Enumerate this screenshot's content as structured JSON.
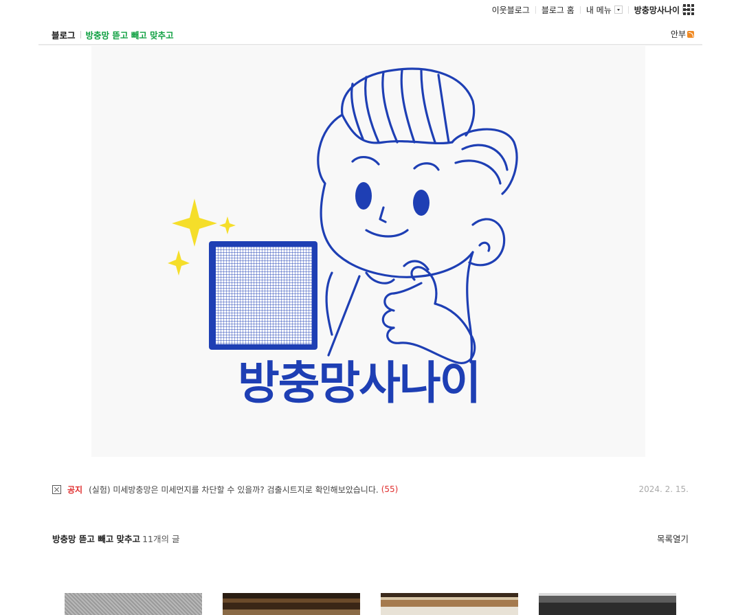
{
  "gnb": {
    "neighbor_blog": "이웃블로그",
    "blog_home": "블로그 홈",
    "my_menu": "내 메뉴",
    "user_name": "방충망사나이"
  },
  "subheader": {
    "blog_label": "블로그",
    "blog_title": "방충망 뜯고 빼고 맞추고",
    "greeting": "안부"
  },
  "banner": {
    "logo_text": "방충망사나이"
  },
  "notice": {
    "tag": "공지",
    "text": "(실험) 미세방충망은 미세먼지를 차단할 수 있을까? 검출시트지로 확인해보았습니다.",
    "comment_count": "(55)",
    "date": "2024. 2. 15."
  },
  "list": {
    "category": "방충망 뜯고 빼고 맞추고",
    "post_count": "11개의 글",
    "open_list": "목록열기"
  },
  "colors": {
    "accent_green": "#10a042",
    "notice_red": "#e02e2e",
    "logo_blue": "#1e3fb4",
    "sparkle_yellow": "#f5de2a"
  },
  "icons": [
    "dropdown-arrow-icon",
    "app-grid-icon",
    "rss-icon",
    "notice-x-icon"
  ]
}
